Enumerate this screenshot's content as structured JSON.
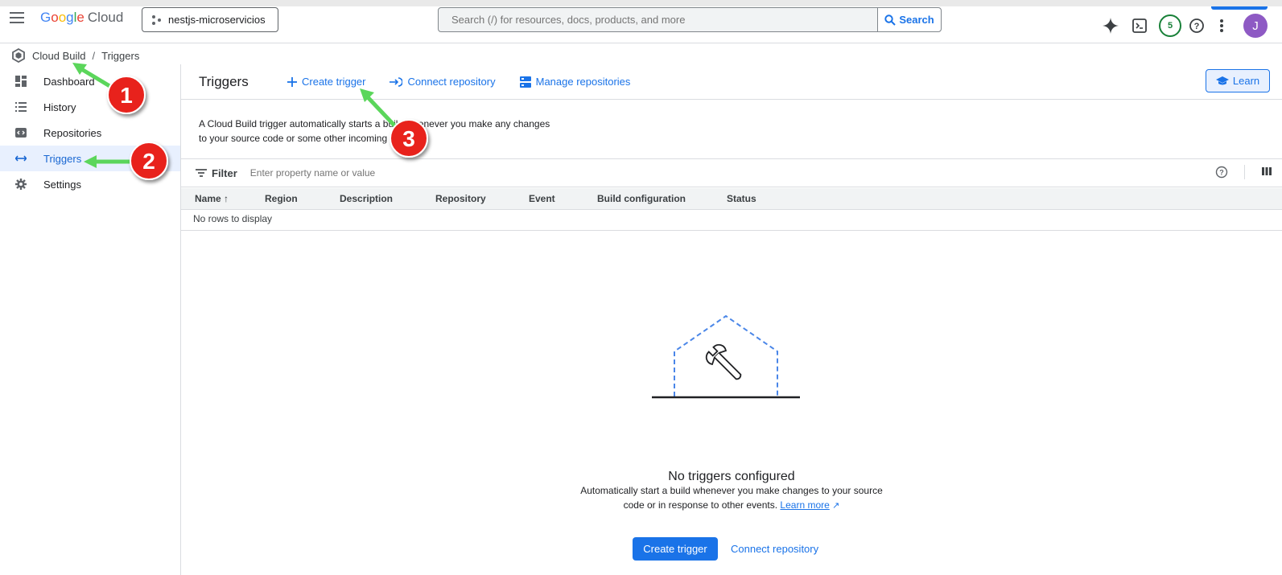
{
  "header": {
    "logo_google": "Google",
    "logo_cloud": "Cloud",
    "project": "nestjs-microservicios",
    "search_placeholder": "Search (/) for resources, docs, products, and more",
    "search_button": "Search",
    "notifications_count": "5",
    "avatar_initial": "J"
  },
  "breadcrumb": {
    "product": "Cloud Build",
    "separator": "/",
    "page": "Triggers"
  },
  "sidebar": {
    "items": [
      {
        "label": "Dashboard",
        "icon": "dashboard-icon"
      },
      {
        "label": "History",
        "icon": "list-icon"
      },
      {
        "label": "Repositories",
        "icon": "repository-icon"
      },
      {
        "label": "Triggers",
        "icon": "trigger-arrow-icon",
        "active": true
      },
      {
        "label": "Settings",
        "icon": "gear-icon"
      }
    ]
  },
  "main": {
    "title": "Triggers",
    "actions": {
      "create": "Create trigger",
      "connect": "Connect repository",
      "manage": "Manage repositories"
    },
    "learn": "Learn",
    "description_line1": "A Cloud Build trigger automatically starts a build whenever you make any changes",
    "description_line2": "to your source code or some other incoming event."
  },
  "filter": {
    "label": "Filter",
    "placeholder": "Enter property name or value"
  },
  "table": {
    "columns": [
      "Name",
      "Region",
      "Description",
      "Repository",
      "Event",
      "Build configuration",
      "Status"
    ],
    "empty": "No rows to display"
  },
  "empty_state": {
    "title": "No triggers configured",
    "description_line1": "Automatically start a build whenever you make changes to your source",
    "description_line2": "code or in response to other events.",
    "learn_more": "Learn more",
    "primary_button": "Create trigger",
    "secondary_button": "Connect repository"
  },
  "annotations": [
    "1",
    "2",
    "3"
  ],
  "colors": {
    "accent": "#1a73e8",
    "annotation_red": "#e8231e",
    "annotation_arrow": "#5bd65b"
  }
}
